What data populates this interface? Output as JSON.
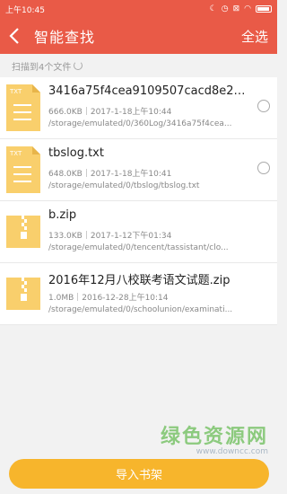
{
  "status_bar": {
    "time": "上午10:45"
  },
  "header": {
    "title": "智能查找",
    "select_all_label": "全选"
  },
  "scan_status": "扫描到4个文件",
  "files": [
    {
      "name": "3416a75f4cea9109507cacd8e2f...",
      "size": "666.0KB",
      "date": "2017-1-18上午10:44",
      "path": "/storage/emulated/0/360Log/3416a75f4cea...",
      "type_label": "TXT"
    },
    {
      "name": "tbslog.txt",
      "size": "648.0KB",
      "date": "2017-1-18上午10:41",
      "path": "/storage/emulated/0/tbslog/tbslog.txt",
      "type_label": "TXT"
    },
    {
      "name": "b.zip",
      "size": "133.0KB",
      "date": "2017-1-12下午01:34",
      "path": "/storage/emulated/0/tencent/tassistant/clo...",
      "type_label": ""
    },
    {
      "name": "2016年12月八校联考语文试题.zip",
      "size": "1.0MB",
      "date": "2016-12-28上午10:14",
      "path": "/storage/emulated/0/schoolunion/examinati...",
      "type_label": ""
    }
  ],
  "watermark": {
    "main": "绿色资源网",
    "sub": "www.downcc.com"
  },
  "import_button_label": "导入书架",
  "colors": {
    "header": "#e95a47",
    "file_icon": "#f9cf6c",
    "button": "#f7b52c",
    "watermark": "#7bc46a"
  }
}
